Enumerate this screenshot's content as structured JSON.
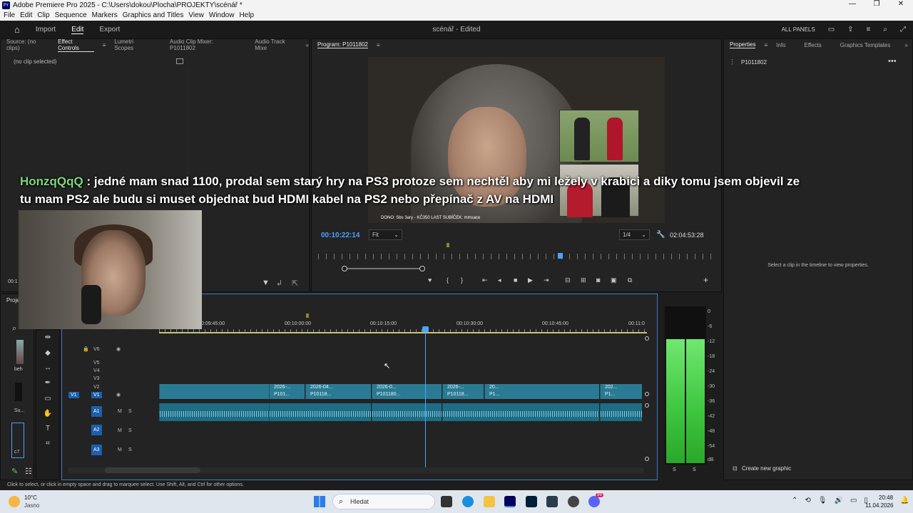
{
  "window": {
    "title": "Adobe Premiere Pro 2025 - C:\\Users\\dokou\\Plocha\\PROJEKTY\\scénář *",
    "logo": "Pr"
  },
  "menu": [
    "File",
    "Edit",
    "Clip",
    "Sequence",
    "Markers",
    "Graphics and Titles",
    "View",
    "Window",
    "Help"
  ],
  "header": {
    "nav": [
      "Import",
      "Edit",
      "Export"
    ],
    "project_title": "scénář - Edited",
    "all_panels": "ALL PANELS"
  },
  "source_panel": {
    "tabs": [
      "Source: (no clips)",
      "Effect Controls",
      "Lumetri Scopes",
      "Audio Clip Mixer: P1011802",
      "Audio Track Mixe"
    ],
    "no_clip": "(no clip selected)",
    "timecode": "00:1"
  },
  "program": {
    "title": "Program: P1011802",
    "timecode": "00:10:22:14",
    "fit": "Fit",
    "quality": "1/4",
    "duration": "02:04:53:28",
    "caption": "DONO: Sbs 3ary - KČ350  LAST SUBÍČEK: mmsace"
  },
  "subtitle": {
    "user": "HonzqQqQ",
    "text": " : jedné mam snad 1100, prodal sem starý hry na PS3 protoze sem nechtěl aby mi ležely v krabici a diky tomu jsem objevil ze tu mam PS2 ale budu si muset objednat bud HDMI kabel na PS2 nebo přepínač z AV na HDMI"
  },
  "properties": {
    "tabs": [
      "Properties",
      "Info",
      "Effects",
      "Graphics Templates"
    ],
    "clip_name": "P1011802",
    "hint": "Select a clip in the timeline to view properties.",
    "create_graphic": "Create new graphic"
  },
  "project_panel": {
    "tab": "Proje",
    "item1": "beh",
    "item2": "Su...",
    "item3": "c7"
  },
  "timeline": {
    "ruler": [
      "0:09:45:00",
      "00:10:00:00",
      "00:10:15:00",
      "00:10:30:00",
      "00:10:45:00",
      "00:11:0"
    ],
    "video_tracks": [
      "V6",
      "V5",
      "V4",
      "V3",
      "V2",
      "V1"
    ],
    "audio_tracks": [
      "A1",
      "A2",
      "A3"
    ],
    "src_v": "V1",
    "clips_top": [
      "2026-...",
      "2026-04...",
      "2026-0...",
      "2026-...",
      "20...",
      "202..."
    ],
    "clips_bottom": [
      "P101...",
      "P10118...",
      "P101180...",
      "P10118...",
      "P1...",
      "P1..."
    ],
    "mute": "M",
    "solo": "S"
  },
  "meter": {
    "scale": [
      "0",
      "-6",
      "-12",
      "-18",
      "-24",
      "-30",
      "-36",
      "-42",
      "-48",
      "-54",
      "dB"
    ],
    "s_labels": [
      "S",
      "S"
    ]
  },
  "status": "Click to select, or click in empty space and drag to marquee select. Use Shift, Alt, and Ctrl for other options.",
  "taskbar": {
    "weather_temp": "10°C",
    "weather_desc": "Jasno",
    "search": "Hledat",
    "time": "20:48",
    "date": "11.04.2026",
    "badge": "99"
  }
}
